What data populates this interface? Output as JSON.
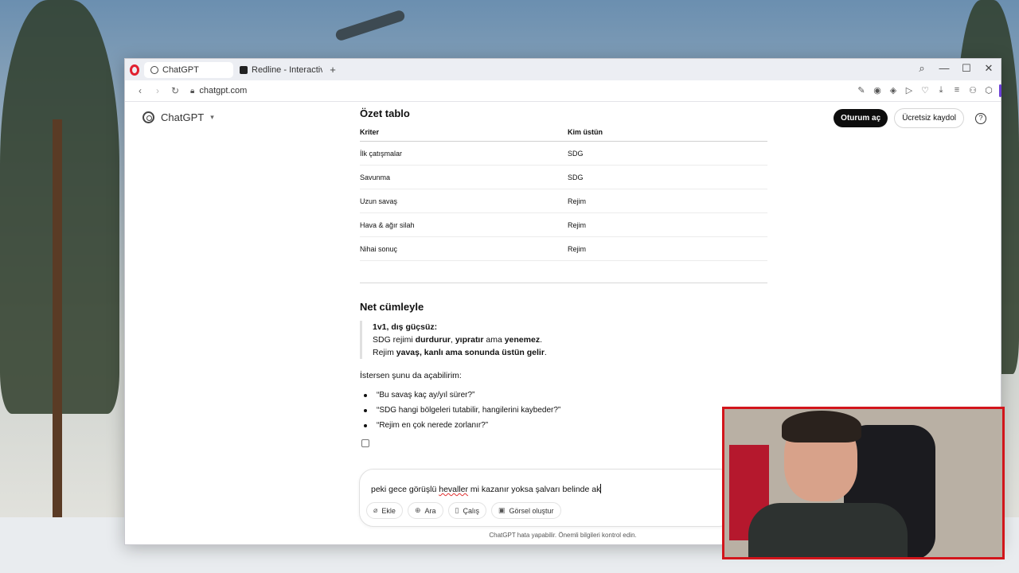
{
  "browser": {
    "tabs": [
      {
        "label": "ChatGPT",
        "active": true
      },
      {
        "label": "Redline - Interactive Strate",
        "active": false
      }
    ],
    "new_tab": "+",
    "url": "chatgpt.com",
    "controls": {
      "minimize": "—",
      "maximize": "☐",
      "close": "✕",
      "search": "⌕"
    }
  },
  "header": {
    "brand": "ChatGPT",
    "login_label": "Oturum aç",
    "signup_label": "Ücretsiz kaydol",
    "help": "?"
  },
  "summary": {
    "title": "Özet tablo",
    "columns": [
      "Kriter",
      "Kim üstün"
    ],
    "rows": [
      [
        "İlk çatışmalar",
        "SDG"
      ],
      [
        "Savunma",
        "SDG"
      ],
      [
        "Uzun savaş",
        "Rejim"
      ],
      [
        "Hava & ağır silah",
        "Rejim"
      ],
      [
        "Nihai sonuç",
        "Rejim"
      ]
    ]
  },
  "net": {
    "title": "Net cümleyle",
    "quote_line1": "1v1, dış güçsüz:",
    "quote_line2_a": "SDG rejimi ",
    "quote_line2_b": "durdurur",
    "quote_line2_c": ", ",
    "quote_line2_d": "yıpratır",
    "quote_line2_e": " ama ",
    "quote_line2_f": "yenemez",
    "quote_line2_g": ".",
    "quote_line3_a": "Rejim ",
    "quote_line3_b": "yavaş, kanlı ama sonunda üstün gelir",
    "quote_line3_c": "."
  },
  "followup": {
    "intro": "İstersen şunu da açabilirim:",
    "suggestions": [
      "“Bu savaş kaç ay/yıl sürer?”",
      "“SDG hangi bölgeleri tutabilir, hangilerini kaybeder?”",
      "“Rejim en çok nerede zorlanır?”"
    ]
  },
  "composer": {
    "text_a": "peki gece görüşlü ",
    "text_misspelled": "hevaller",
    "text_b": " mi kazanır yoksa şalvarı belinde ak",
    "tools": [
      {
        "label": "Ekle",
        "icon": "paperclip-icon"
      },
      {
        "label": "Ara",
        "icon": "globe-icon"
      },
      {
        "label": "Çalış",
        "icon": "book-icon"
      },
      {
        "label": "Görsel oluştur",
        "icon": "image-icon"
      }
    ]
  },
  "disclaimer": "ChatGPT hata yapabilir. Önemli bilgileri kontrol edin."
}
